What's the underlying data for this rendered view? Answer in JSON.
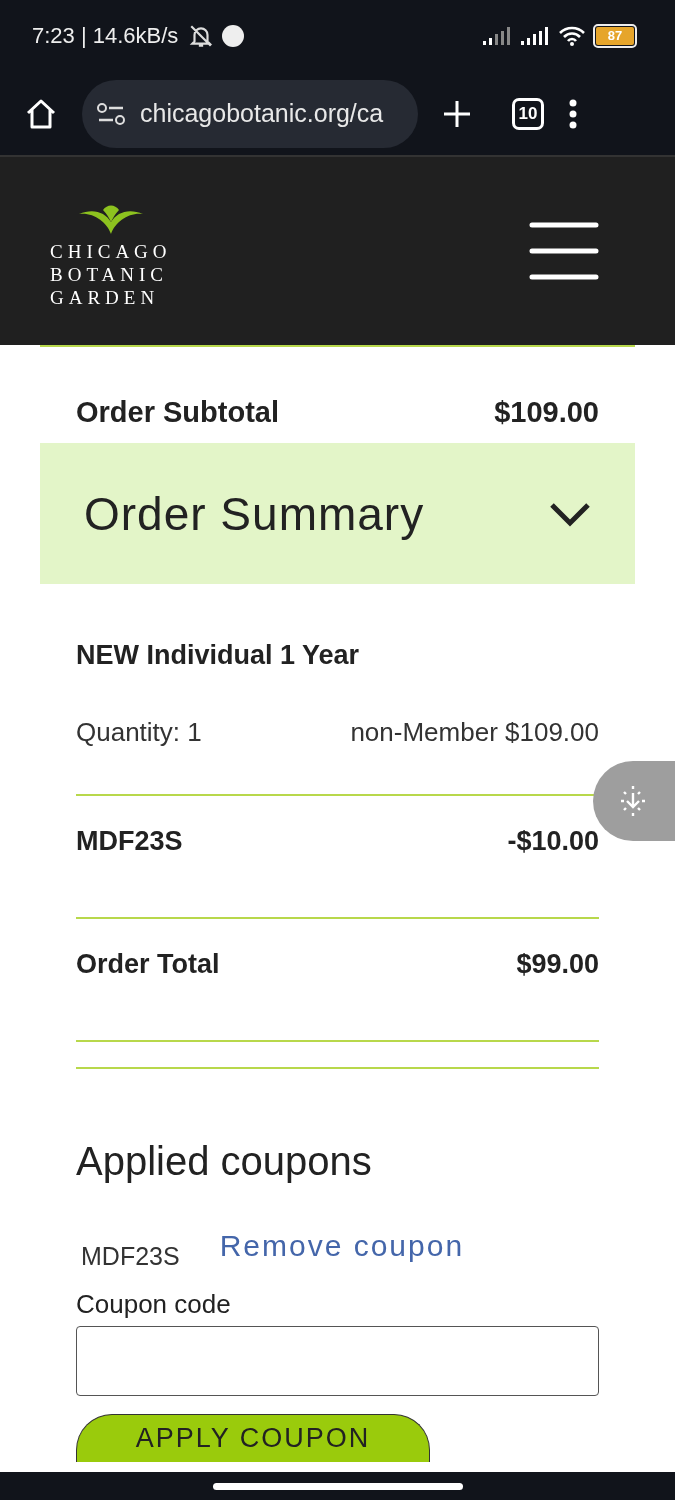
{
  "status_bar": {
    "time_speed": "7:23 | 14.6kB/s",
    "battery": "87"
  },
  "browser": {
    "url": "chicagobotanic.org/ca",
    "tab_count": "10"
  },
  "site_header": {
    "logo_lines": [
      "CHICAGO",
      "BOTANIC",
      "GARDEN"
    ]
  },
  "order": {
    "subtotal": {
      "label": "Order Subtotal",
      "value": "$109.00"
    },
    "summary": {
      "title": "Order Summary",
      "expanded": true
    },
    "items": [
      {
        "name": "NEW Individual 1 Year",
        "quantity": "Quantity: 1",
        "price": "non-Member $109.00"
      }
    ],
    "discount": {
      "code": "MDF23S",
      "amount": "-$10.00"
    },
    "total": {
      "label": "Order Total",
      "value": "$99.00"
    }
  },
  "coupons": {
    "heading": "Applied coupons",
    "applied": [
      {
        "code": "MDF23S",
        "action": "Remove coupon"
      }
    ],
    "field_label": "Coupon code",
    "button": "APPLY COUPON"
  }
}
